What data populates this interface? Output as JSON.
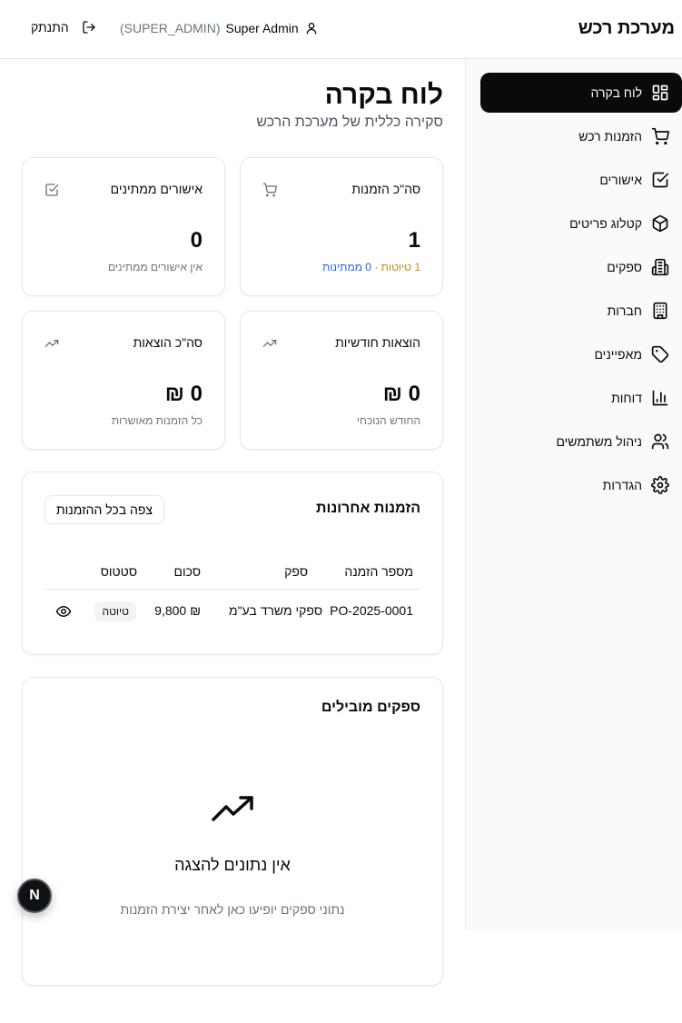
{
  "header": {
    "brand": "מערכת רכש",
    "user_name": "Super Admin",
    "user_role": "(SUPER_ADMIN)",
    "logout_label": "התנתק"
  },
  "sidebar": {
    "items": [
      {
        "label": "לוח בקרה",
        "icon": "dashboard-icon",
        "active": true
      },
      {
        "label": "הזמנות רכש",
        "icon": "cart-icon"
      },
      {
        "label": "אישורים",
        "icon": "check-square-icon"
      },
      {
        "label": "קטלוג פריטים",
        "icon": "package-icon"
      },
      {
        "label": "ספקים",
        "icon": "building-icon"
      },
      {
        "label": "חברות",
        "icon": "office-building-icon"
      },
      {
        "label": "מאפיינים",
        "icon": "tag-icon"
      },
      {
        "label": "דוחות",
        "icon": "bar-chart-icon"
      },
      {
        "label": "ניהול משתמשים",
        "icon": "users-icon"
      },
      {
        "label": "הגדרות",
        "icon": "gear-icon"
      }
    ]
  },
  "page": {
    "title": "לוח בקרה",
    "subtitle": "סקירה כללית של מערכת הרכש"
  },
  "stats": {
    "total_orders": {
      "title": "סה\"כ הזמנות",
      "value": "1",
      "drafts": "1 טיוטות",
      "sep": " · ",
      "pending": "0 ממתינות"
    },
    "pending_approvals": {
      "title": "אישורים ממתינים",
      "value": "0",
      "desc": "אין אישורים ממתינים"
    },
    "monthly_expenses": {
      "title": "הוצאות חודשיות",
      "value": "0 ₪",
      "desc": "החודש הנוכחי"
    },
    "total_expenses": {
      "title": "סה\"כ הוצאות",
      "value": "0 ₪",
      "desc": "כל הזמנות מאושרות"
    }
  },
  "recent_orders": {
    "title": "הזמנות אחרונות",
    "view_all": "צפה בכל ההזמנות",
    "columns": {
      "number": "מספר הזמנה",
      "supplier": "ספק",
      "amount": "סכום",
      "status": "סטטוס"
    },
    "rows": [
      {
        "number": "PO-2025-0001",
        "supplier": "ספקי משרד בע\"מ",
        "amount": "₪ 9,800",
        "status": "טיוטה"
      }
    ]
  },
  "top_suppliers": {
    "title": "ספקים מובילים",
    "empty_title": "אין נתונים להצגה",
    "empty_desc": "נתוני ספקים יופיעו כאן לאחר יצירת הזמנות"
  },
  "fab_label": "N",
  "colors": {
    "active_bg": "#0a0a0a",
    "drafts": "#ca8a04",
    "pending": "#2563eb"
  }
}
